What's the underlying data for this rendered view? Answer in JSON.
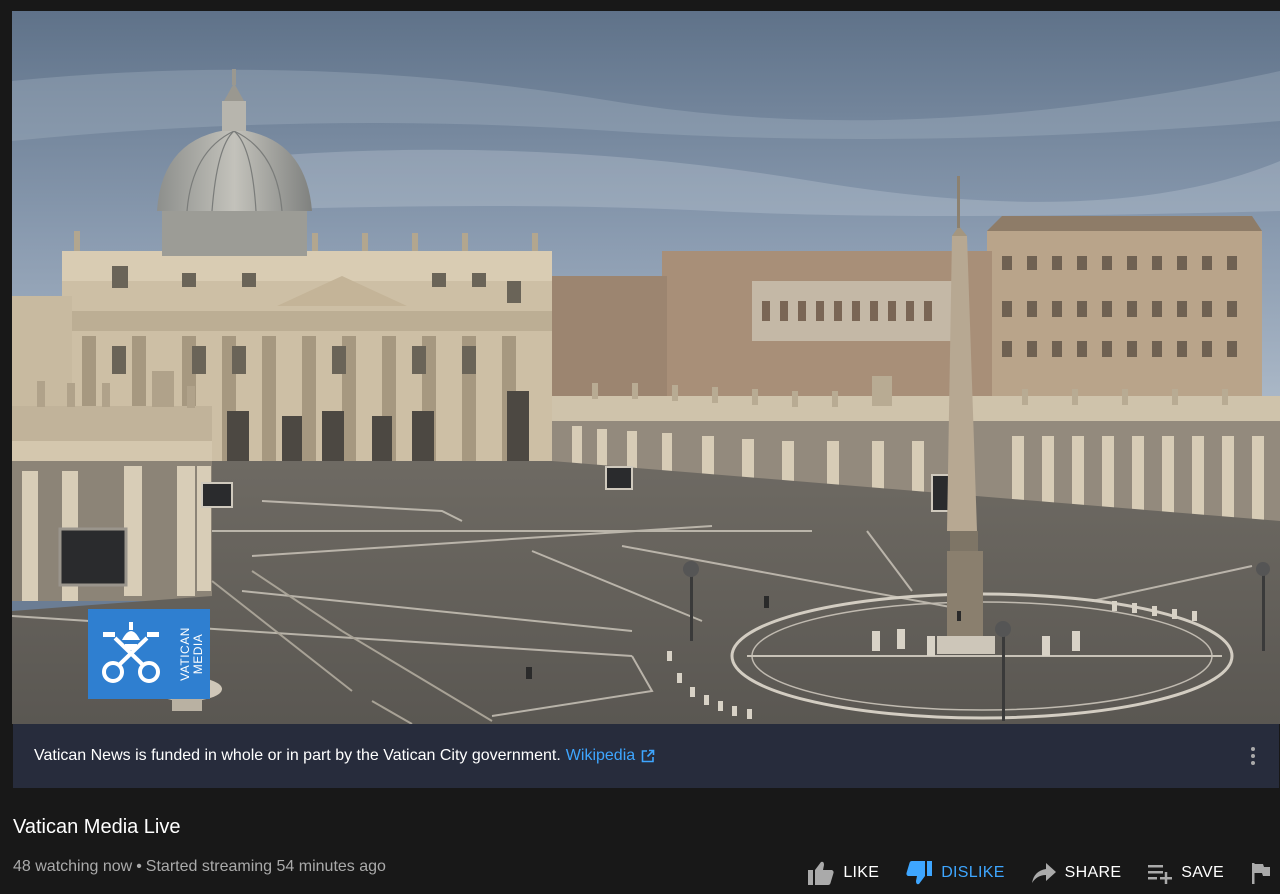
{
  "player": {
    "logo_line1": "VATICAN",
    "logo_line2": "MEDIA",
    "logo_icon": "vatican-keys-emblem",
    "brand_color": "#2f7fd0"
  },
  "info_panel": {
    "text": "Vatican News is funded in whole or in part by the Vatican City government.",
    "link_label": "Wikipedia",
    "link_icon": "external-link-icon",
    "link_color": "#3ea6ff"
  },
  "video": {
    "title": "Vatican Media Live",
    "watching": "48 watching now",
    "separator": "•",
    "started": "Started streaming 54 minutes ago"
  },
  "actions": [
    {
      "id": "like",
      "label": "LIKE",
      "icon": "thumbs-up-icon",
      "active": false
    },
    {
      "id": "dislike",
      "label": "DISLIKE",
      "icon": "thumbs-down-icon",
      "active": true
    },
    {
      "id": "share",
      "label": "SHARE",
      "icon": "share-icon",
      "active": false
    },
    {
      "id": "save",
      "label": "SAVE",
      "icon": "playlist-add-icon",
      "active": false
    },
    {
      "id": "report",
      "label": "",
      "icon": "flag-icon",
      "active": false
    }
  ],
  "colors": {
    "background": "#181818",
    "panel": "#272c3c",
    "accent": "#3ea6ff",
    "secondary_text": "#aaaaaa"
  }
}
